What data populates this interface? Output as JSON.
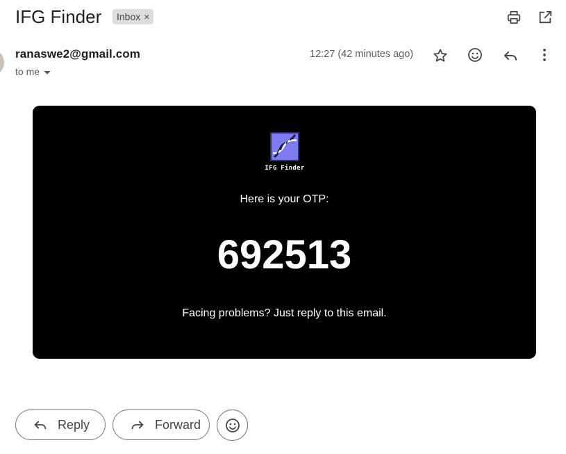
{
  "header": {
    "subject": "IFG Finder",
    "label": "Inbox",
    "label_remove": "×",
    "icons": [
      "print-icon",
      "open-in-new-window-icon"
    ]
  },
  "message": {
    "sender": "ranaswe2@gmail.com",
    "recipient_line": "to me",
    "time": "12:27 (42 minutes ago)",
    "action_icons": [
      "star-icon",
      "emoji-reaction-icon",
      "reply-icon",
      "more-options-icon"
    ]
  },
  "body": {
    "logo_text": "IFG Finder",
    "otp_intro": "Here is your OTP:",
    "otp_code": "692513",
    "help_text": "Facing problems? Just reply to this email.",
    "card_color": "#000000",
    "logo_color": "#7c7cf0"
  },
  "footer": {
    "reply_label": "Reply",
    "forward_label": "Forward"
  }
}
